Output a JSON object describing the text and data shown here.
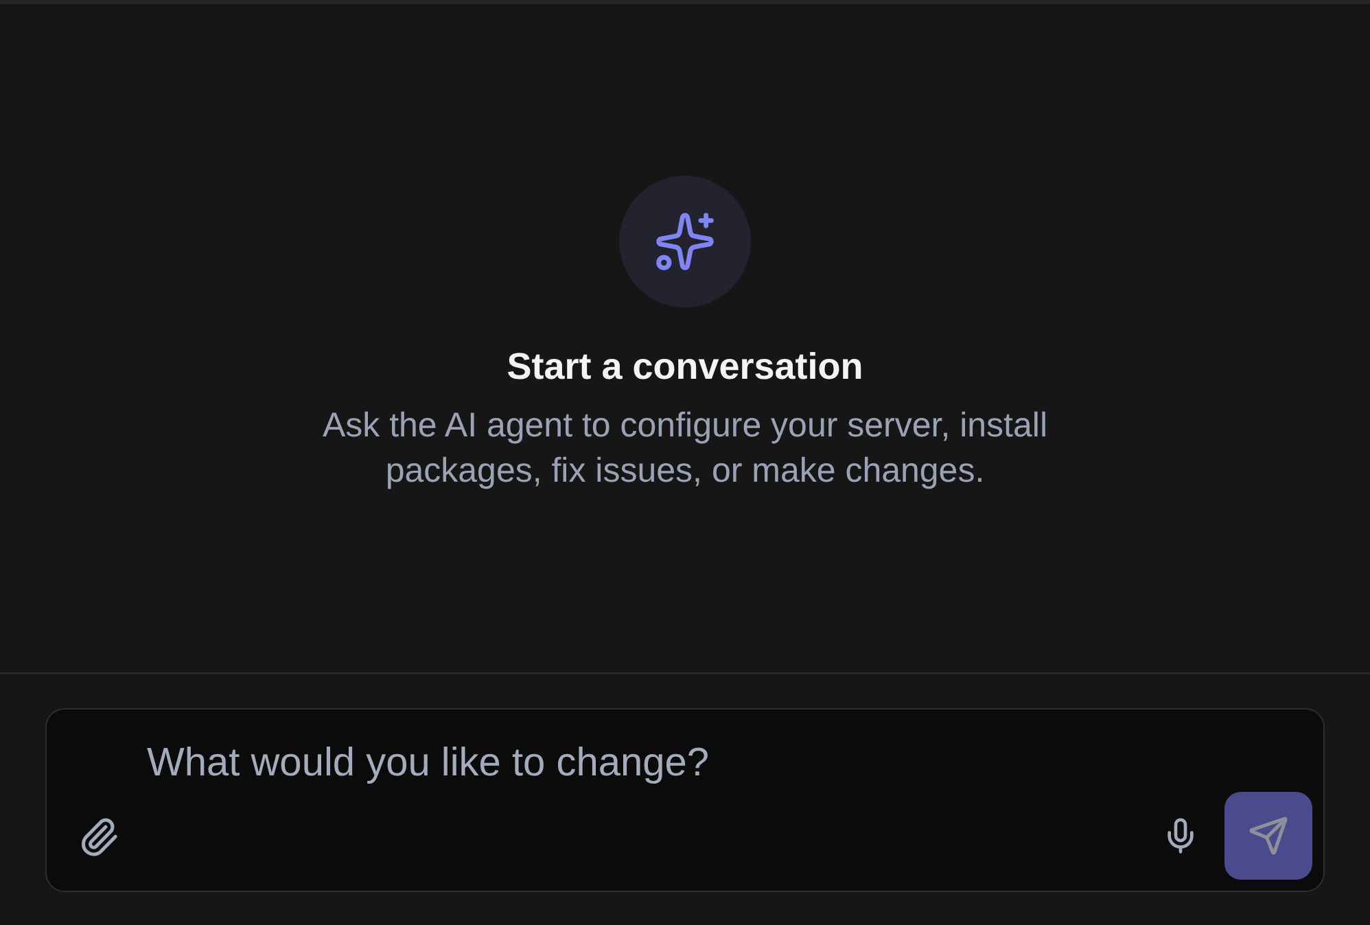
{
  "empty_state": {
    "title": "Start a conversation",
    "description": "Ask the AI agent to configure your server, install packages, fix issues, or make changes."
  },
  "composer": {
    "placeholder": "What would you like to change?",
    "send_button": {
      "disabled": true
    }
  }
}
